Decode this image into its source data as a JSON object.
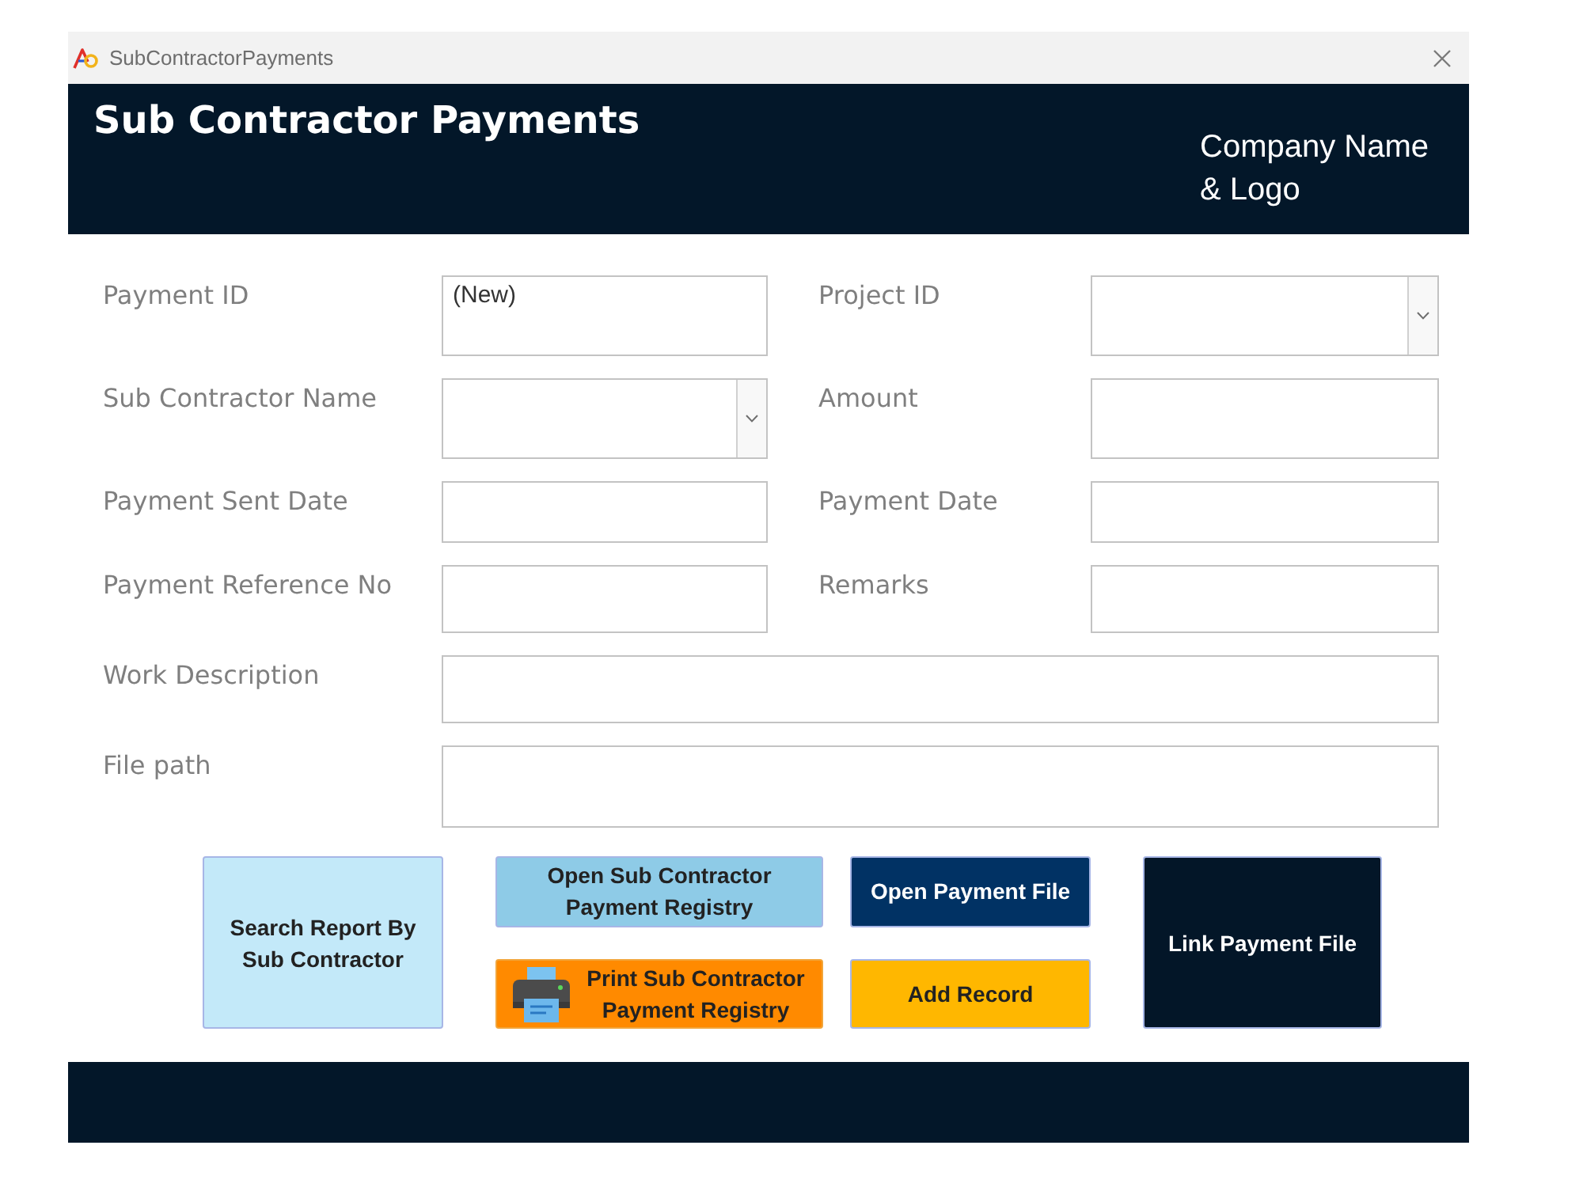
{
  "window": {
    "title": "SubContractorPayments"
  },
  "header": {
    "title": "Sub Contractor Payments",
    "company": "Company Name & Logo"
  },
  "form": {
    "rows": [
      [
        {
          "label": "Payment ID",
          "kind": "text",
          "value": "(New)"
        },
        {
          "label": "Project ID",
          "kind": "combo"
        }
      ],
      [
        {
          "label": "Sub Contractor Name",
          "kind": "combo"
        },
        {
          "label": "Amount",
          "kind": "text"
        }
      ],
      [
        {
          "label": "Payment Sent Date",
          "kind": "text"
        },
        {
          "label": "Payment Date",
          "kind": "text"
        }
      ],
      [
        {
          "label": "Payment Reference No",
          "kind": "text"
        },
        {
          "label": "Remarks",
          "kind": "text"
        }
      ],
      [
        {
          "label": "Work Description",
          "kind": "text"
        }
      ],
      [
        {
          "label": "File path",
          "kind": "text"
        }
      ]
    ]
  },
  "buttons": [
    [
      {
        "label": "Search Report By Sub Contractor",
        "kind": "text",
        "color": "#c3e9f9"
      }
    ],
    [
      {
        "label": "Open Sub Contractor Payment Registry",
        "kind": "text",
        "color": "#8ecbe7"
      },
      {
        "label": "Print Sub Contractor Payment Registry",
        "kind": "icon",
        "color": "#ff8a00"
      }
    ],
    [
      {
        "label": "Open Payment File",
        "kind": "text",
        "color": "#013264"
      },
      {
        "label": "Add Record",
        "kind": "text",
        "color": "#ffb700"
      }
    ],
    [
      {
        "label": "Link Payment File",
        "kind": "text",
        "color": "#031628"
      }
    ]
  ]
}
